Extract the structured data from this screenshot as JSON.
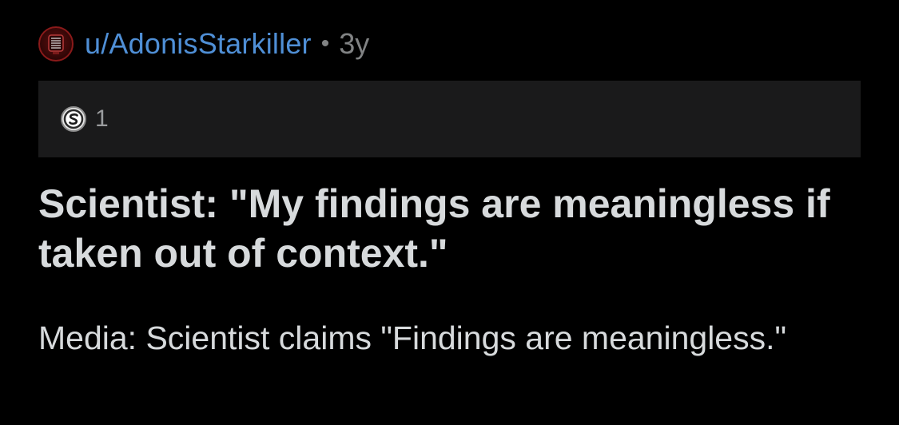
{
  "post": {
    "author": "u/AdonisStarkiller",
    "separator": "•",
    "age": "3y",
    "avatar_icon": "red-avatar-icon",
    "awards": {
      "icon": "silver-award-icon",
      "count": "1"
    },
    "title": "Scientist: \"My findings are meaningless if taken out of context.\"",
    "body": "Media: Scientist claims \"Findings are meaningless.\""
  },
  "colors": {
    "background": "#000000",
    "awards_bar": "#1a1a1b",
    "username": "#4f8fd6",
    "meta_text": "#818384",
    "primary_text": "#d7dadc"
  }
}
